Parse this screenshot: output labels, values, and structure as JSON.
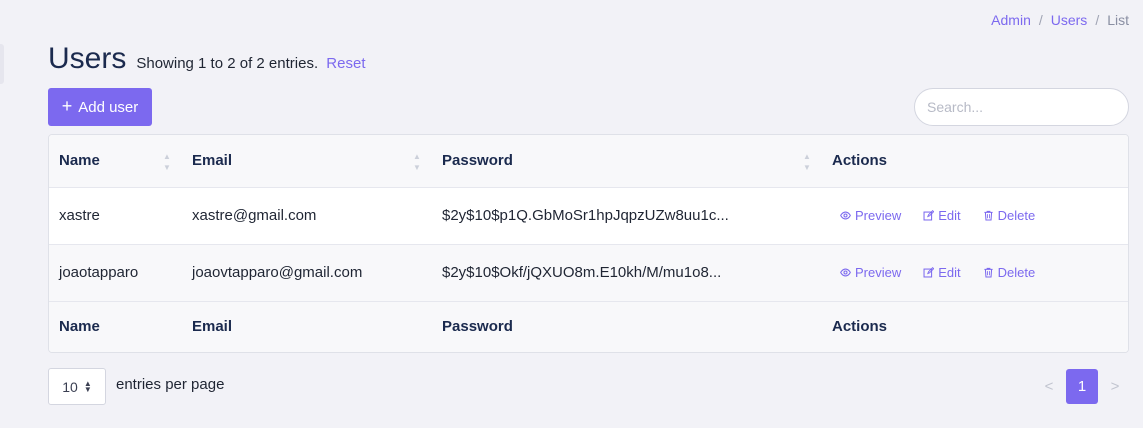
{
  "breadcrumb": {
    "items": [
      "Admin",
      "Users",
      "List"
    ],
    "separator": "/"
  },
  "header": {
    "title": "Users",
    "subtitle": "Showing 1 to 2 of 2 entries.",
    "reset_label": "Reset"
  },
  "toolbar": {
    "add_label": "Add user",
    "add_icon": "plus-icon"
  },
  "search": {
    "placeholder": "Search..."
  },
  "table": {
    "columns": [
      "Name",
      "Email",
      "Password",
      "Actions"
    ],
    "rows": [
      {
        "name": "xastre",
        "email": "xastre@gmail.com",
        "password": "$2y$10$p1Q.GbMoSr1hpJqpzUZw8uu1c..."
      },
      {
        "name": "joaotapparo",
        "email": "joaovtapparo@gmail.com",
        "password": "$2y$10$Okf/jQXUO8m.E10kh/M/mu1o8..."
      }
    ],
    "actions": {
      "preview": "Preview",
      "edit": "Edit",
      "delete": "Delete"
    }
  },
  "pagination": {
    "per_page": "10",
    "per_page_label": "entries per page",
    "current_page": "1",
    "prev": "<",
    "next": ">"
  },
  "colors": {
    "accent": "#7c69ef",
    "background": "#f2f2f7"
  }
}
